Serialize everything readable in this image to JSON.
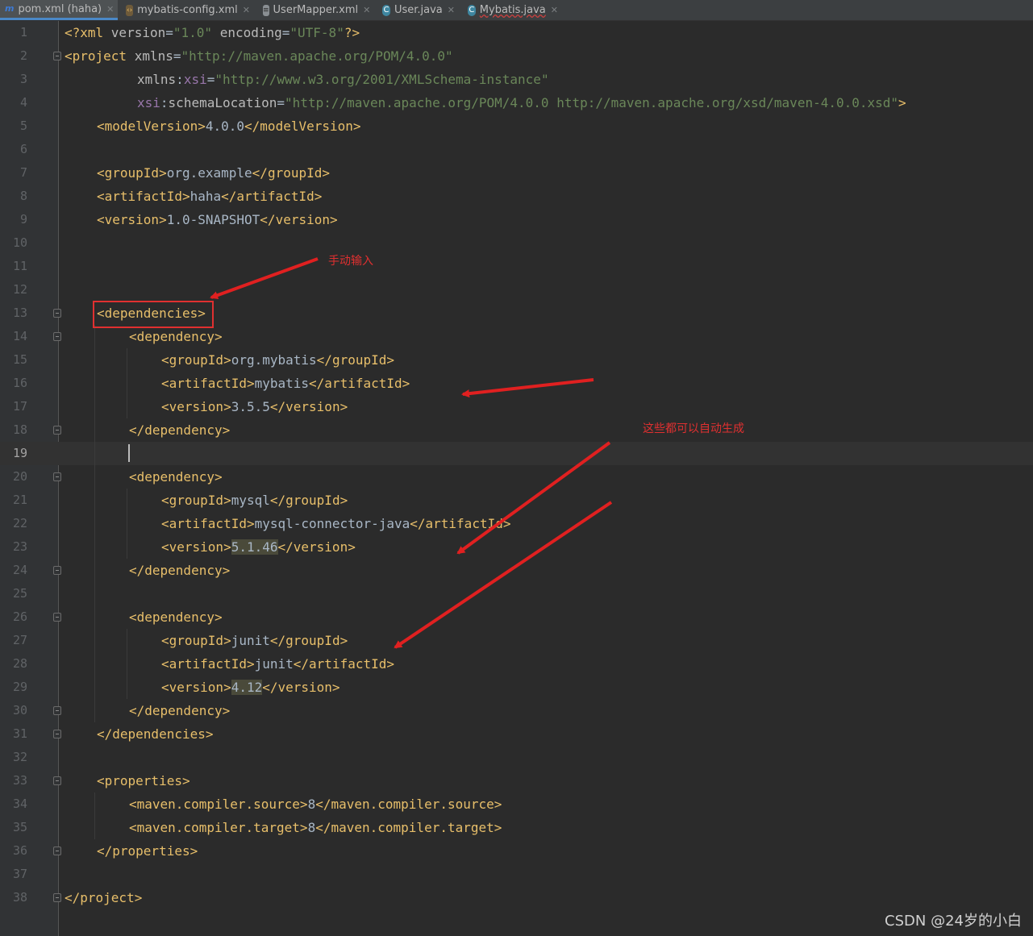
{
  "tabs": [
    {
      "label": "pom.xml (haha)",
      "icon": "maven-icon",
      "active": true
    },
    {
      "label": "mybatis-config.xml",
      "icon": "xml-icon"
    },
    {
      "label": "UserMapper.xml",
      "icon": "xml-file-icon"
    },
    {
      "label": "User.java",
      "icon": "java-class-icon"
    },
    {
      "label": "Mybatis.java",
      "icon": "java-class-icon"
    }
  ],
  "current_line": 19,
  "lines": [
    {
      "n": "1",
      "indent": 0,
      "parts": [
        [
          "pi",
          "<?xml "
        ],
        [
          "attr",
          "version"
        ],
        [
          "p",
          "="
        ],
        [
          "val",
          "\"1.0\""
        ],
        [
          "p",
          " "
        ],
        [
          "attr",
          "encoding"
        ],
        [
          "p",
          "="
        ],
        [
          "val",
          "\"UTF-8\""
        ],
        [
          "pi",
          "?>"
        ]
      ]
    },
    {
      "n": "2",
      "indent": 0,
      "parts": [
        [
          "tag",
          "<project "
        ],
        [
          "attr",
          "xmlns"
        ],
        [
          "p",
          "="
        ],
        [
          "val",
          "\"http://maven.apache.org/POM/4.0.0\""
        ]
      ]
    },
    {
      "n": "3",
      "indent": 9,
      "parts": [
        [
          "attr",
          "xmlns"
        ],
        [
          "p",
          ":"
        ],
        [
          "ns",
          "xsi"
        ],
        [
          "p",
          "="
        ],
        [
          "val",
          "\"http://www.w3.org/2001/XMLSchema-instance\""
        ]
      ]
    },
    {
      "n": "4",
      "indent": 9,
      "parts": [
        [
          "ns",
          "xsi"
        ],
        [
          "p",
          ":"
        ],
        [
          "attr",
          "schemaLocation"
        ],
        [
          "p",
          "="
        ],
        [
          "val",
          "\"http://maven.apache.org/POM/4.0.0 http://maven.apache.org/xsd/maven-4.0.0.xsd\""
        ],
        [
          "tag",
          ">"
        ]
      ]
    },
    {
      "n": "5",
      "indent": 4,
      "parts": [
        [
          "tag",
          "<modelVersion>"
        ],
        [
          "p",
          "4.0.0"
        ],
        [
          "tag",
          "</modelVersion>"
        ]
      ]
    },
    {
      "n": "6",
      "indent": 0,
      "parts": []
    },
    {
      "n": "7",
      "indent": 4,
      "parts": [
        [
          "tag",
          "<groupId>"
        ],
        [
          "p",
          "org.example"
        ],
        [
          "tag",
          "</groupId>"
        ]
      ]
    },
    {
      "n": "8",
      "indent": 4,
      "parts": [
        [
          "tag",
          "<artifactId>"
        ],
        [
          "p",
          "haha"
        ],
        [
          "tag",
          "</artifactId>"
        ]
      ]
    },
    {
      "n": "9",
      "indent": 4,
      "parts": [
        [
          "tag",
          "<version>"
        ],
        [
          "p",
          "1.0-SNAPSHOT"
        ],
        [
          "tag",
          "</version>"
        ]
      ]
    },
    {
      "n": "10",
      "indent": 0,
      "parts": []
    },
    {
      "n": "11",
      "indent": 0,
      "parts": []
    },
    {
      "n": "12",
      "indent": 0,
      "parts": []
    },
    {
      "n": "13",
      "indent": 4,
      "parts": [
        [
          "tag",
          "<dependencies>"
        ]
      ]
    },
    {
      "n": "14",
      "indent": 8,
      "parts": [
        [
          "tag",
          "<dependency>"
        ]
      ]
    },
    {
      "n": "15",
      "indent": 12,
      "parts": [
        [
          "tag",
          "<groupId>"
        ],
        [
          "p",
          "org.mybatis"
        ],
        [
          "tag",
          "</groupId>"
        ]
      ]
    },
    {
      "n": "16",
      "indent": 12,
      "parts": [
        [
          "tag",
          "<artifactId>"
        ],
        [
          "p",
          "mybatis"
        ],
        [
          "tag",
          "</artifactId>"
        ]
      ]
    },
    {
      "n": "17",
      "indent": 12,
      "parts": [
        [
          "tag",
          "<version>"
        ],
        [
          "p",
          "3.5.5"
        ],
        [
          "tag",
          "</version>"
        ]
      ]
    },
    {
      "n": "18",
      "indent": 8,
      "parts": [
        [
          "tag",
          "</dependency>"
        ]
      ]
    },
    {
      "n": "19",
      "indent": 0,
      "parts": []
    },
    {
      "n": "20",
      "indent": 8,
      "parts": [
        [
          "tag",
          "<dependency>"
        ]
      ]
    },
    {
      "n": "21",
      "indent": 12,
      "parts": [
        [
          "tag",
          "<groupId>"
        ],
        [
          "p",
          "mysql"
        ],
        [
          "tag",
          "</groupId>"
        ]
      ]
    },
    {
      "n": "22",
      "indent": 12,
      "parts": [
        [
          "tag",
          "<artifactId>"
        ],
        [
          "p",
          "mysql-connector-java"
        ],
        [
          "tag",
          "</artifactId>"
        ]
      ]
    },
    {
      "n": "23",
      "indent": 12,
      "parts": [
        [
          "tag",
          "<version>"
        ],
        [
          "hl",
          "5.1.46"
        ],
        [
          "tag",
          "</version>"
        ]
      ]
    },
    {
      "n": "24",
      "indent": 8,
      "parts": [
        [
          "tag",
          "</dependency>"
        ]
      ]
    },
    {
      "n": "25",
      "indent": 0,
      "parts": []
    },
    {
      "n": "26",
      "indent": 8,
      "parts": [
        [
          "tag",
          "<dependency>"
        ]
      ]
    },
    {
      "n": "27",
      "indent": 12,
      "parts": [
        [
          "tag",
          "<groupId>"
        ],
        [
          "p",
          "junit"
        ],
        [
          "tag",
          "</groupId>"
        ]
      ]
    },
    {
      "n": "28",
      "indent": 12,
      "parts": [
        [
          "tag",
          "<artifactId>"
        ],
        [
          "p",
          "junit"
        ],
        [
          "tag",
          "</artifactId>"
        ]
      ]
    },
    {
      "n": "29",
      "indent": 12,
      "parts": [
        [
          "tag",
          "<version>"
        ],
        [
          "hl",
          "4.12"
        ],
        [
          "tag",
          "</version>"
        ]
      ]
    },
    {
      "n": "30",
      "indent": 8,
      "parts": [
        [
          "tag",
          "</dependency>"
        ]
      ]
    },
    {
      "n": "31",
      "indent": 4,
      "parts": [
        [
          "tag",
          "</dependencies>"
        ]
      ]
    },
    {
      "n": "32",
      "indent": 0,
      "parts": []
    },
    {
      "n": "33",
      "indent": 4,
      "parts": [
        [
          "tag",
          "<properties>"
        ]
      ]
    },
    {
      "n": "34",
      "indent": 8,
      "parts": [
        [
          "tag",
          "<maven.compiler.source>"
        ],
        [
          "p",
          "8"
        ],
        [
          "tag",
          "</maven.compiler.source>"
        ]
      ]
    },
    {
      "n": "35",
      "indent": 8,
      "parts": [
        [
          "tag",
          "<maven.compiler.target>"
        ],
        [
          "p",
          "8"
        ],
        [
          "tag",
          "</maven.compiler.target>"
        ]
      ]
    },
    {
      "n": "36",
      "indent": 4,
      "parts": [
        [
          "tag",
          "</properties>"
        ]
      ]
    },
    {
      "n": "37",
      "indent": 0,
      "parts": []
    },
    {
      "n": "38",
      "indent": 0,
      "parts": [
        [
          "tag",
          "</project>"
        ]
      ]
    }
  ],
  "fold_lines": [
    2,
    13,
    14,
    18,
    20,
    24,
    26,
    30,
    31,
    33,
    36,
    38
  ],
  "annotations": {
    "manual_input": "手动输入",
    "auto_generate": "这些都可以自动生成",
    "color": "#e03030"
  },
  "watermark": "CSDN @24岁的小白",
  "colors": {
    "tag": "#e8bf6a",
    "value": "#6a8759",
    "text": "#a9b7c6",
    "namespace": "#9876aa",
    "background": "#2b2b2b"
  }
}
